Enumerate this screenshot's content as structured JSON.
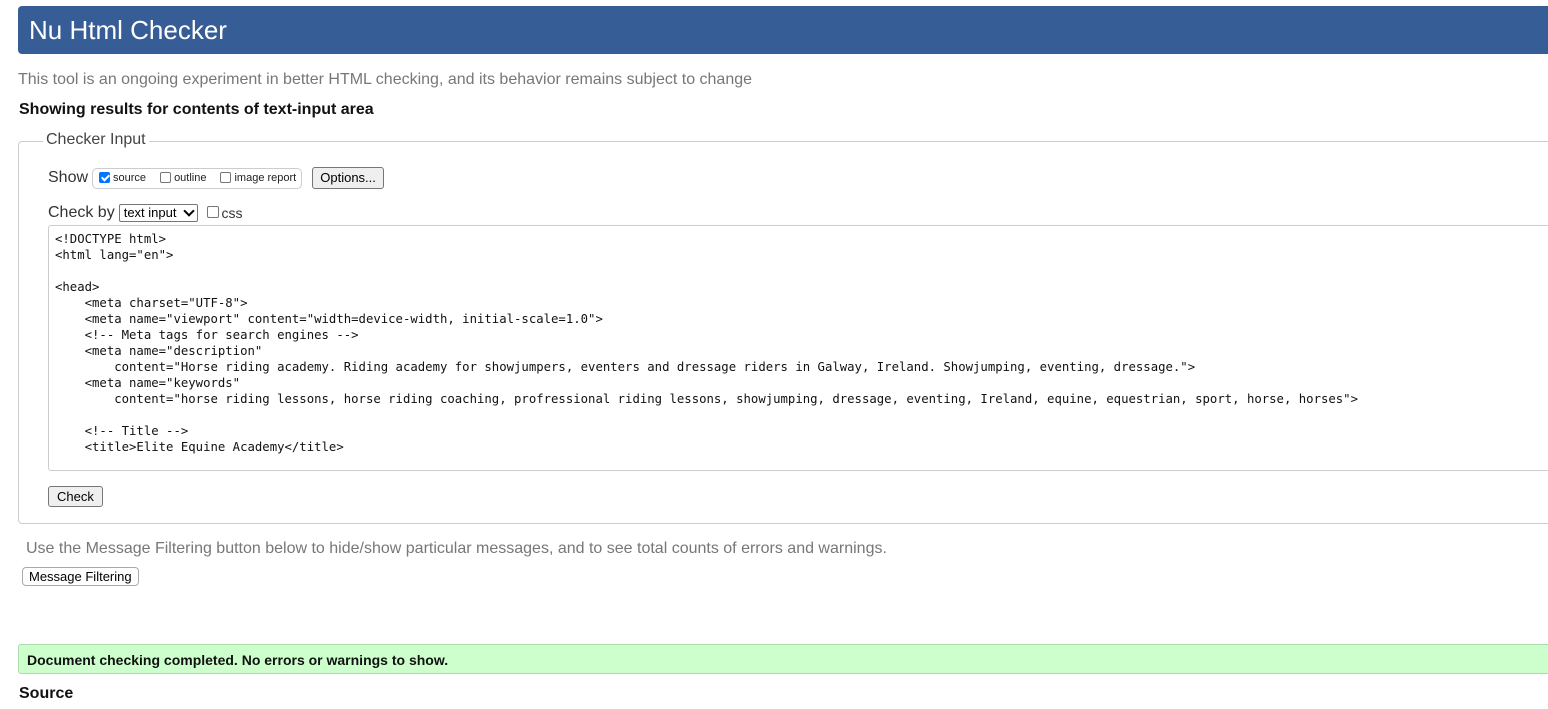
{
  "header": {
    "title": "Nu Html Checker"
  },
  "subtitle": "This tool is an ongoing experiment in better HTML checking, and its behavior remains subject to change",
  "results_heading": "Showing results for contents of text-input area",
  "checker_input": {
    "legend": "Checker Input",
    "show_label": "Show",
    "show_options": [
      {
        "label": "source",
        "checked": true
      },
      {
        "label": "outline",
        "checked": false
      },
      {
        "label": "image report",
        "checked": false
      }
    ],
    "options_button": "Options...",
    "check_by_label": "Check by",
    "check_by_value": "text input",
    "css_label": "css",
    "css_checked": false,
    "source_lines": [
      "<!DOCTYPE html>",
      "<html lang=\"en\">",
      "",
      "<head>",
      "    <meta charset=\"UTF-8\">",
      "    <meta name=\"viewport\" content=\"width=device-width, initial-scale=1.0\">",
      "    <!-- Meta tags for search engines -->",
      "    <meta name=\"description\"",
      "        content=\"Horse riding academy. Riding academy for showjumpers, eventers and dressage riders in Galway, Ireland. Showjumping, eventing, dressage.\">",
      "    <meta name=\"keywords\"",
      "        content=\"horse riding lessons, horse riding coaching, profressional riding lessons, showjumping, dressage, eventing, Ireland, equine, equestrian, sport, horse, horses\">",
      "",
      "    <!-- Title -->",
      "    <title>Elite Equine Academy</title>"
    ],
    "check_button": "Check"
  },
  "filter_hint": "Use the Message Filtering button below to hide/show particular messages, and to see total counts of errors and warnings.",
  "filter_button": "Message Filtering",
  "success_message": "Document checking completed. No errors or warnings to show.",
  "source_heading": "Source",
  "colors": {
    "header_bg": "#365d95",
    "success_bg": "#ccffcc",
    "checkbox_checked": "#0075ff"
  }
}
